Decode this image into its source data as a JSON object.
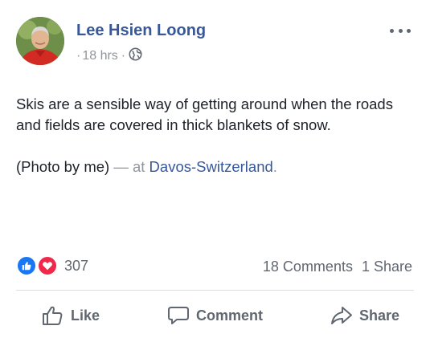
{
  "post": {
    "author": "Lee Hsien Loong",
    "timestamp": "18 hrs",
    "meta_separator_before": "·",
    "meta_separator_after": "·",
    "audience_icon": "globe-icon",
    "more_icon": "more-options-icon",
    "text_line_1": "Skis are a sensible way of getting around when the roads and fields are covered in thick blankets of snow.",
    "photo_credit": "(Photo by me)",
    "location_prefix": "— at",
    "location_name": "Davos-Switzerland",
    "location_suffix": "."
  },
  "reactions": {
    "icons": [
      "like-reaction-icon",
      "love-reaction-icon"
    ],
    "count": "307",
    "like_color": "#1877f2",
    "love_color": "#f0284a"
  },
  "engagement": {
    "comments": "18 Comments",
    "shares": "1 Share"
  },
  "actions": {
    "like_label": "Like",
    "comment_label": "Comment",
    "share_label": "Share"
  },
  "colors": {
    "author_link": "#385898",
    "meta": "#90949c",
    "body_text": "#1d2129",
    "action_text": "#606770"
  }
}
